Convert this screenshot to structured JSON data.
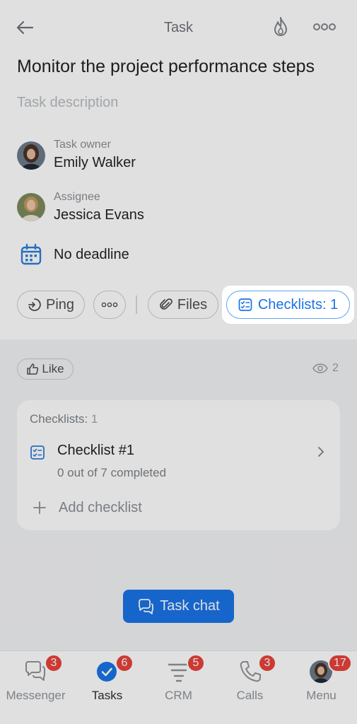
{
  "header": {
    "title": "Task"
  },
  "task": {
    "title": "Monitor the project performance steps",
    "description_placeholder": "Task description"
  },
  "owner": {
    "label": "Task owner",
    "name": "Emily Walker"
  },
  "assignee": {
    "label": "Assignee",
    "name": "Jessica Evans"
  },
  "deadline": {
    "text": "No deadline"
  },
  "actions": {
    "ping_label": "Ping",
    "files_label": "Files",
    "checklists_label": "Checklists: 1"
  },
  "reactions": {
    "like_label": "Like",
    "views_count": "2"
  },
  "checklists_card": {
    "header_label": "Checklists:",
    "header_count": "1",
    "items": [
      {
        "name": "Checklist #1",
        "progress": "0 out of 7 completed"
      }
    ],
    "add_label": "Add checklist"
  },
  "chat_button": {
    "label": "Task chat"
  },
  "tabbar": {
    "tabs": [
      {
        "label": "Messenger",
        "badge": "3"
      },
      {
        "label": "Tasks",
        "badge": "6"
      },
      {
        "label": "CRM",
        "badge": "5"
      },
      {
        "label": "Calls",
        "badge": "3"
      },
      {
        "label": "Menu",
        "badge": "17"
      }
    ]
  },
  "colors": {
    "accent": "#1a73e8",
    "badge": "#e8423b",
    "highlight_border": "#5ea4ee"
  },
  "icons": [
    "back-arrow-icon",
    "flame-icon",
    "more-dots-icon",
    "calendar-icon",
    "ping-icon",
    "paperclip-icon",
    "checklist-icon",
    "thumbs-up-icon",
    "eye-icon",
    "chevron-right-icon",
    "plus-icon",
    "chat-icon",
    "messenger-icon",
    "tasks-check-icon",
    "crm-funnel-icon",
    "phone-icon",
    "user-avatar-icon"
  ]
}
